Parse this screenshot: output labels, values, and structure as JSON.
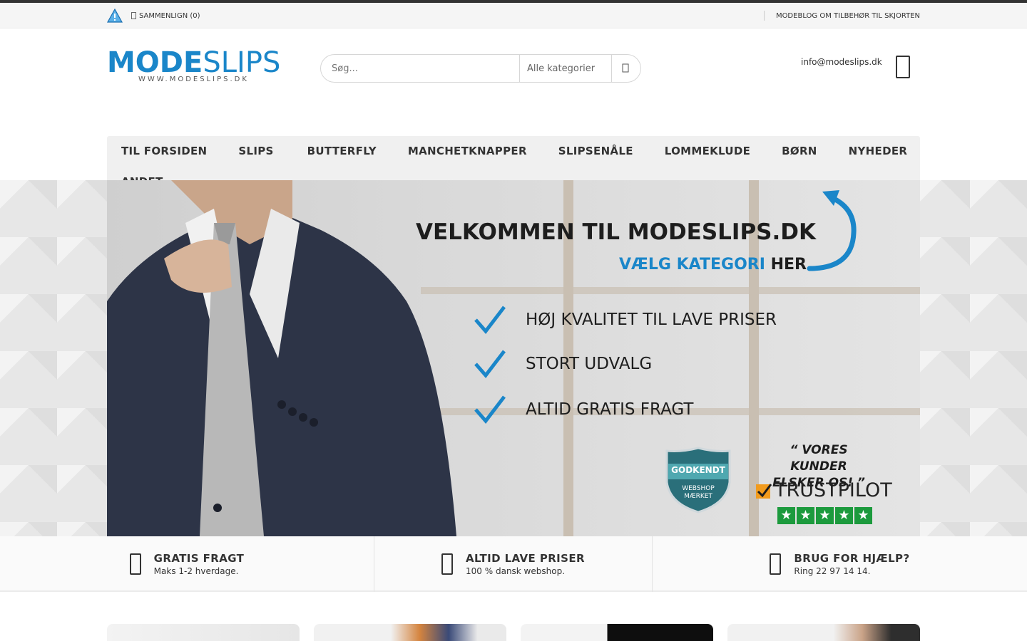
{
  "topbar": {
    "compare_label": "SAMMENLIGN (0)",
    "blog_link": "MODEBLOG OM TILBEHØR TIL SKJORTEN"
  },
  "logo": {
    "part1": "MODE",
    "part2": "SLIPS",
    "sub": "WWW.MODESLIPS.DK"
  },
  "search": {
    "placeholder": "Søg...",
    "category": "Alle kategorier",
    "button_icon": "search-icon"
  },
  "header": {
    "email": "info@modeslips.dk",
    "cart_icon": "cart-icon"
  },
  "nav": {
    "items": [
      {
        "label": "TIL FORSIDEN"
      },
      {
        "label": "SLIPS"
      },
      {
        "label": "BUTTERFLY"
      },
      {
        "label": "MANCHETKNAPPER"
      },
      {
        "label": "SLIPSENÅLE"
      },
      {
        "label": "LOMMEKLUDE"
      },
      {
        "label": "BØRN"
      },
      {
        "label": "NYHEDER"
      },
      {
        "label": "ANDET"
      }
    ]
  },
  "hero": {
    "welcome": "VELKOMMEN TIL MODESLIPS.DK",
    "choose_blue": "VÆLG KATEGORI",
    "choose_dark": "HER",
    "checks": [
      "HØJ KVALITET TIL LAVE PRISER",
      "STORT UDVALG",
      "ALTID GRATIS FRAGT"
    ],
    "badge_title": "GODKENDT",
    "badge_line1": "WEBSHOP",
    "badge_line2": "MÆRKET",
    "quote_line1": "“ VORES KUNDER",
    "quote_line2": "ELSKER OS! ”",
    "trustpilot": "TRUSTPILOT",
    "stars": 5
  },
  "features": [
    {
      "title": "GRATIS FRAGT",
      "text": "Maks 1-2 hverdage."
    },
    {
      "title": "ALTID LAVE PRISER",
      "text": "100 % dansk webshop."
    },
    {
      "title": "BRUG FOR HJÆLP?",
      "text": "Ring 22 97 14 14."
    }
  ],
  "colors": {
    "brand_blue": "#1a86c9",
    "trustpilot_green": "#1c9a3d",
    "nav_bg": "#f0f0f0"
  }
}
